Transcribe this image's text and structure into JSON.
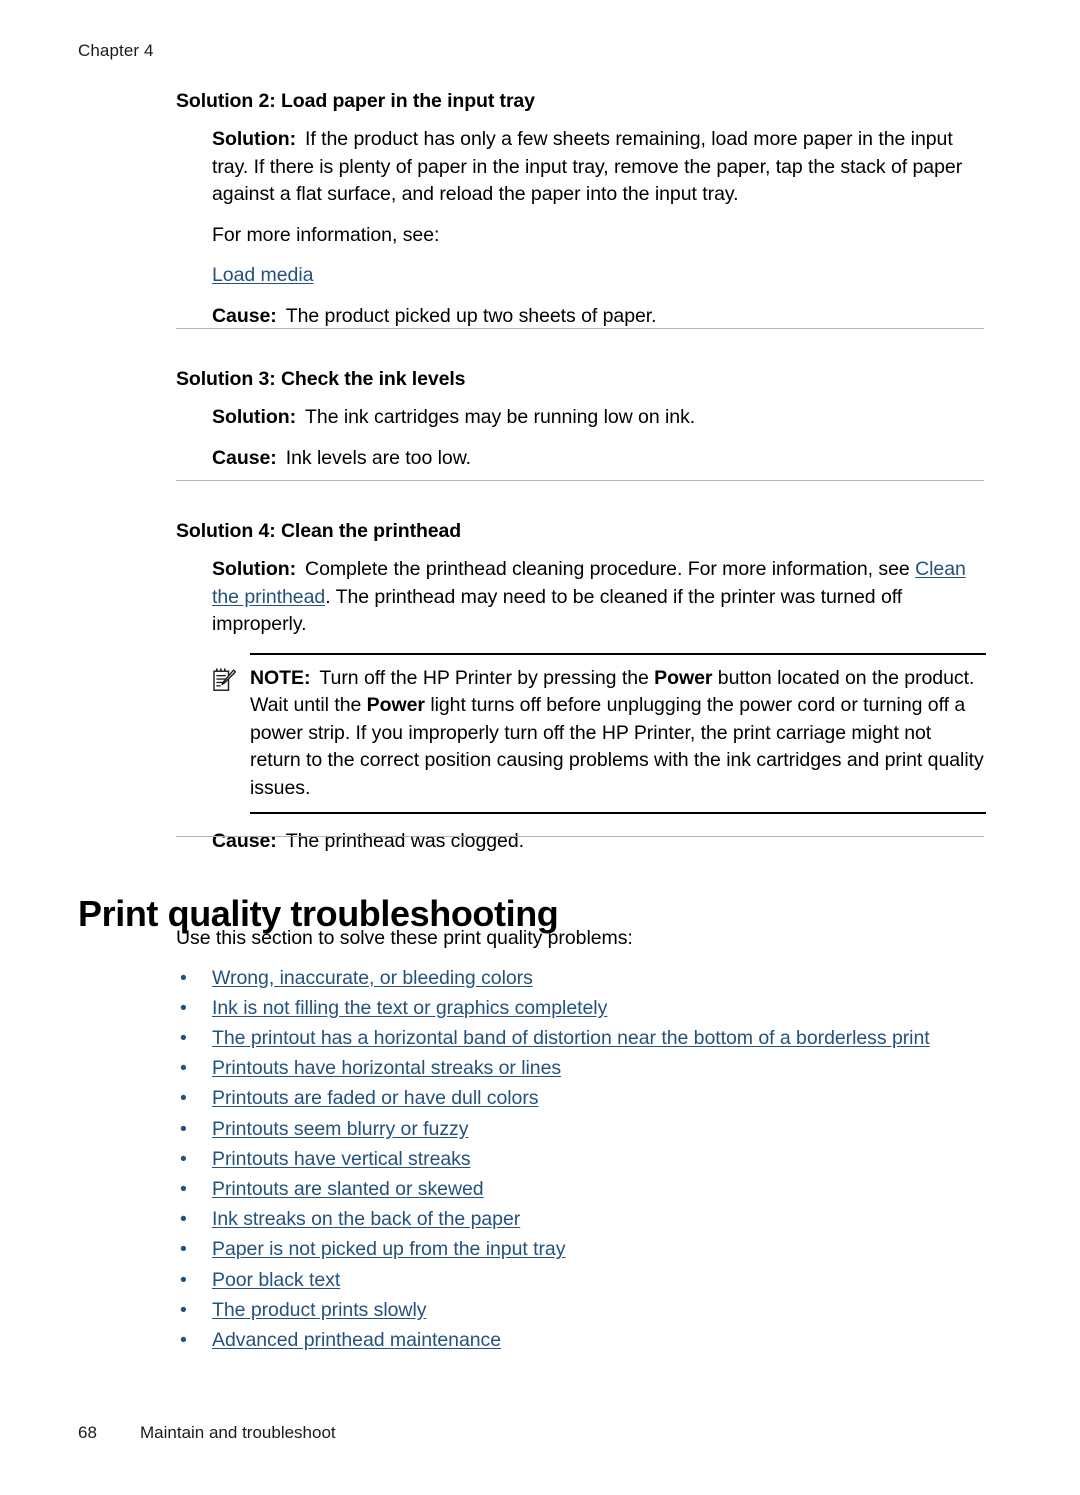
{
  "page": {
    "chapter_label": "Chapter 4",
    "footer_page_number": "68",
    "footer_section": "Maintain and troubleshoot",
    "link_color": "#24527f",
    "rule_color_light": "#b3b3b3",
    "rule_color_dark": "#000000"
  },
  "solutions": [
    {
      "heading": "Solution 2: Load paper in the input tray",
      "solution_label": "Solution:",
      "solution_text": "If the product has only a few sheets remaining, load more paper in the input tray. If there is plenty of paper in the input tray, remove the paper, tap the stack of paper against a flat surface, and reload the paper into the input tray.",
      "more_info_text": "For more information, see:",
      "more_info_link": "Load media",
      "cause_label": "Cause:",
      "cause_text": "The product picked up two sheets of paper."
    },
    {
      "heading": "Solution 3: Check the ink levels",
      "solution_label": "Solution:",
      "solution_text": "The ink cartridges may be running low on ink.",
      "cause_label": "Cause:",
      "cause_text": "Ink levels are too low."
    },
    {
      "heading": "Solution 4: Clean the printhead",
      "solution_label": "Solution:",
      "solution_text_before_link": "Complete the printhead cleaning procedure. For more information, see ",
      "solution_link": "Clean the printhead",
      "solution_text_after_link": ". The printhead may need to be cleaned if the printer was turned off improperly.",
      "cause_label": "Cause:",
      "cause_text": "The printhead was clogged."
    }
  ],
  "note": {
    "icon": "note-pad-pencil-icon",
    "label": "NOTE:",
    "text_part_1": "Turn off the HP Printer by pressing the ",
    "bold_1": "Power",
    "text_part_2": " button located on the product. Wait until the ",
    "bold_2": "Power",
    "text_part_3": " light turns off before unplugging the power cord or turning off a power strip. If you improperly turn off the HP Printer, the print carriage might not return to the correct position causing problems with the ink cartridges and print quality issues."
  },
  "main_section": {
    "title": "Print quality troubleshooting",
    "intro": "Use this section to solve these print quality problems:",
    "bullet_char": "•",
    "links": [
      "Wrong, inaccurate, or bleeding colors",
      "Ink is not filling the text or graphics completely",
      "The printout has a horizontal band of distortion near the bottom of a borderless print",
      "Printouts have horizontal streaks or lines",
      "Printouts are faded or have dull colors",
      "Printouts seem blurry or fuzzy",
      "Printouts have vertical streaks",
      "Printouts are slanted or skewed",
      "Ink streaks on the back of the paper",
      "Paper is not picked up from the input tray",
      "Poor black text",
      "The product prints slowly",
      "Advanced printhead maintenance"
    ]
  }
}
